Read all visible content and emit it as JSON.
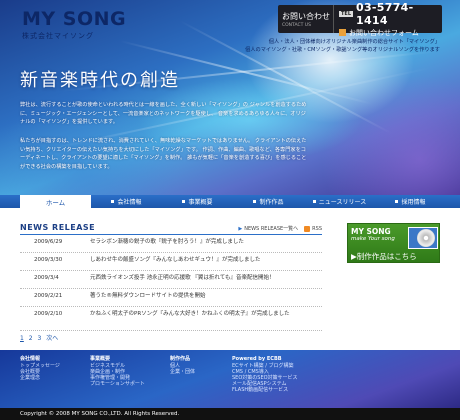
{
  "header": {
    "logo_main": "MY SONG",
    "logo_sub": "株式会社マイソング",
    "contact": {
      "label": "お問い合わせ",
      "label_sub": "CONTACT US",
      "tel_badge": "TEL",
      "tel": "03-5774-1414",
      "form_label": "お問い合わせフォーム"
    },
    "tagline": [
      "個人・法人・団体様向けオリジナル楽曲制作の総合サイト「マイソング」",
      "個人のマイソング・社歌・CMソング・歌謡ソング等のオリジナルソングを作ります"
    ]
  },
  "hero": {
    "title": "新音楽時代の創造",
    "paragraph1": "弊社は、流行することが歌の使命といわれる時代とは一線を画した、全く新しい「マイソング」の ジャンルを創造するために、ミュージック・エージェンシーとして、一流音楽家とのネットワークを駆使し、 音楽を求めるあらゆる人々に、オリジナルの「マイソング」を提供しています。",
    "paragraph2": "私たちが目指すのは、トレンドに流され、消費されていく、無味乾燥なマーケットではありません。 クライアントの伝えたい気持ち、クリエイターの伝えたい気持ちを大切にした「マイソング」です。 作詞、作曲、編曲、歌唱など、各専門家をコーディネートし、クライアントの要望に適した「マイソング」を制作。 誰もが気軽に「音楽を創造する喜び」を感じることができる社会の構築を目指しています。"
  },
  "nav": {
    "items": [
      {
        "label": "ホーム",
        "active": true
      },
      {
        "label": "会社情報",
        "active": false
      },
      {
        "label": "事業概要",
        "active": false
      },
      {
        "label": "制作作品",
        "active": false
      },
      {
        "label": "ニュースリリース",
        "active": false
      },
      {
        "label": "採用情報",
        "active": false
      }
    ]
  },
  "news": {
    "title": "NEWS RELEASE",
    "list_link": "NEWS RELEASE一覧へ",
    "rss_label": "RSS",
    "items": [
      {
        "date": "2009/6/29",
        "text": "セラシボン漸穂の鋭子の歌『鋭子を肘ろう！』が完成しました"
      },
      {
        "date": "2009/3/30",
        "text": "しあわせ牛の飯盛ソング『みんなしあわせギュウ！』が完成しました"
      },
      {
        "date": "2009/3/4",
        "text": "元西鉄ライオンズ投手 池永正明の応援歌 『翼は折れても』音楽配信開始！"
      },
      {
        "date": "2009/2/21",
        "text": "著うた®無料ダウンロードサイトの提供を開始"
      },
      {
        "date": "2009/2/10",
        "text": "かねふく明太子のPRソング『みんな大好き！かねふくの明太子』が完成しました"
      }
    ],
    "pager": [
      "1",
      "2",
      "3",
      "次へ"
    ]
  },
  "banner": {
    "title": "MY SONG",
    "subtitle": "make Your song",
    "cta": "▶制作作品はこちら"
  },
  "footer": {
    "columns": [
      {
        "heading": "会社情報",
        "links": [
          "トップメッセージ",
          "会社概要",
          "企業理念"
        ]
      },
      {
        "heading": "事業概要",
        "links": [
          "ビジネスモデル",
          "楽曲企画・制作",
          "事作権管理・開発",
          "プロモーションサポート"
        ]
      },
      {
        "heading": "制作作品",
        "links": [
          "個人",
          "企業・団体"
        ]
      },
      {
        "heading": "Powered by ECBB",
        "links": [
          "ECサイト構築 / ブログ構築",
          "CMS / CMS導入",
          "SEO対策のSEO対策サービス",
          "メール配信ASPシステム",
          "FLASH動画配信サービス"
        ]
      }
    ],
    "copyright": "Copyright © 2008 MY SONG CO.,LTD. All Rights Reserved."
  },
  "colors": {
    "brand_navy": "#0d2766",
    "nav_blue": "#1c56ab",
    "banner_green": "#3a8a20",
    "rss_orange": "#f08a24"
  }
}
